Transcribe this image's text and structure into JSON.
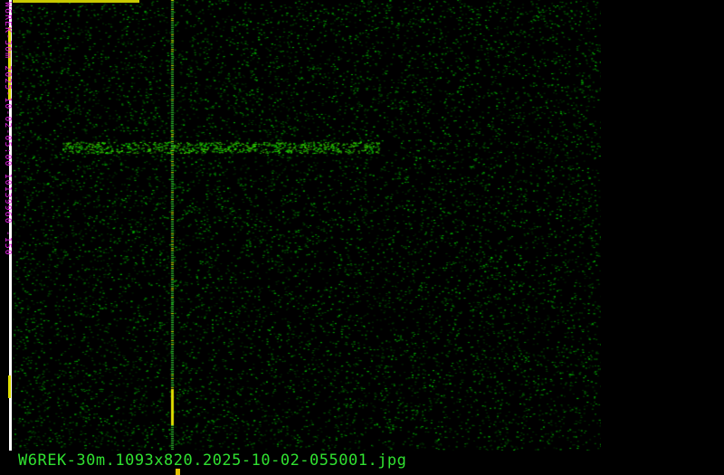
{
  "waterfall": {
    "vertical_label": "W6REK-30m 2025-10-02-05:00 10139960 -150",
    "caption": "W6REK-30m.1093x820.2025-10-02-055001.jpg",
    "colors": {
      "signal": "#30e030",
      "label": "#e020e0",
      "marker": "#e0e000"
    }
  }
}
